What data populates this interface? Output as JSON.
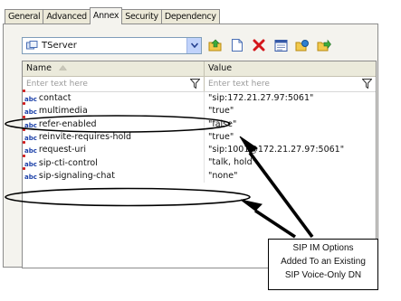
{
  "tabs": [
    "General",
    "Advanced",
    "Annex",
    "Security",
    "Dependency"
  ],
  "toolbar": {
    "combo_value": "TServer"
  },
  "grid": {
    "headers": {
      "name": "Name",
      "value": "Value"
    },
    "filter_placeholders": {
      "name": "Enter text here",
      "value": "Enter text here"
    },
    "rows": [
      {
        "name": "contact",
        "value": "\"sip:172.21.27.97:5061\""
      },
      {
        "name": "multimedia",
        "value": "\"true\""
      },
      {
        "name": "refer-enabled",
        "value": "\"false\""
      },
      {
        "name": "reinvite-requires-hold",
        "value": "\"true\""
      },
      {
        "name": "request-uri",
        "value": "\"sip:1001@172.21.27.97:5061\""
      },
      {
        "name": "sip-cti-control",
        "value": "\"talk, hold\""
      },
      {
        "name": "sip-signaling-chat",
        "value": "\"none\""
      }
    ]
  },
  "callout": {
    "lines": [
      "SIP IM Options",
      "Added To an Existing",
      "SIP Voice-Only DN"
    ]
  }
}
